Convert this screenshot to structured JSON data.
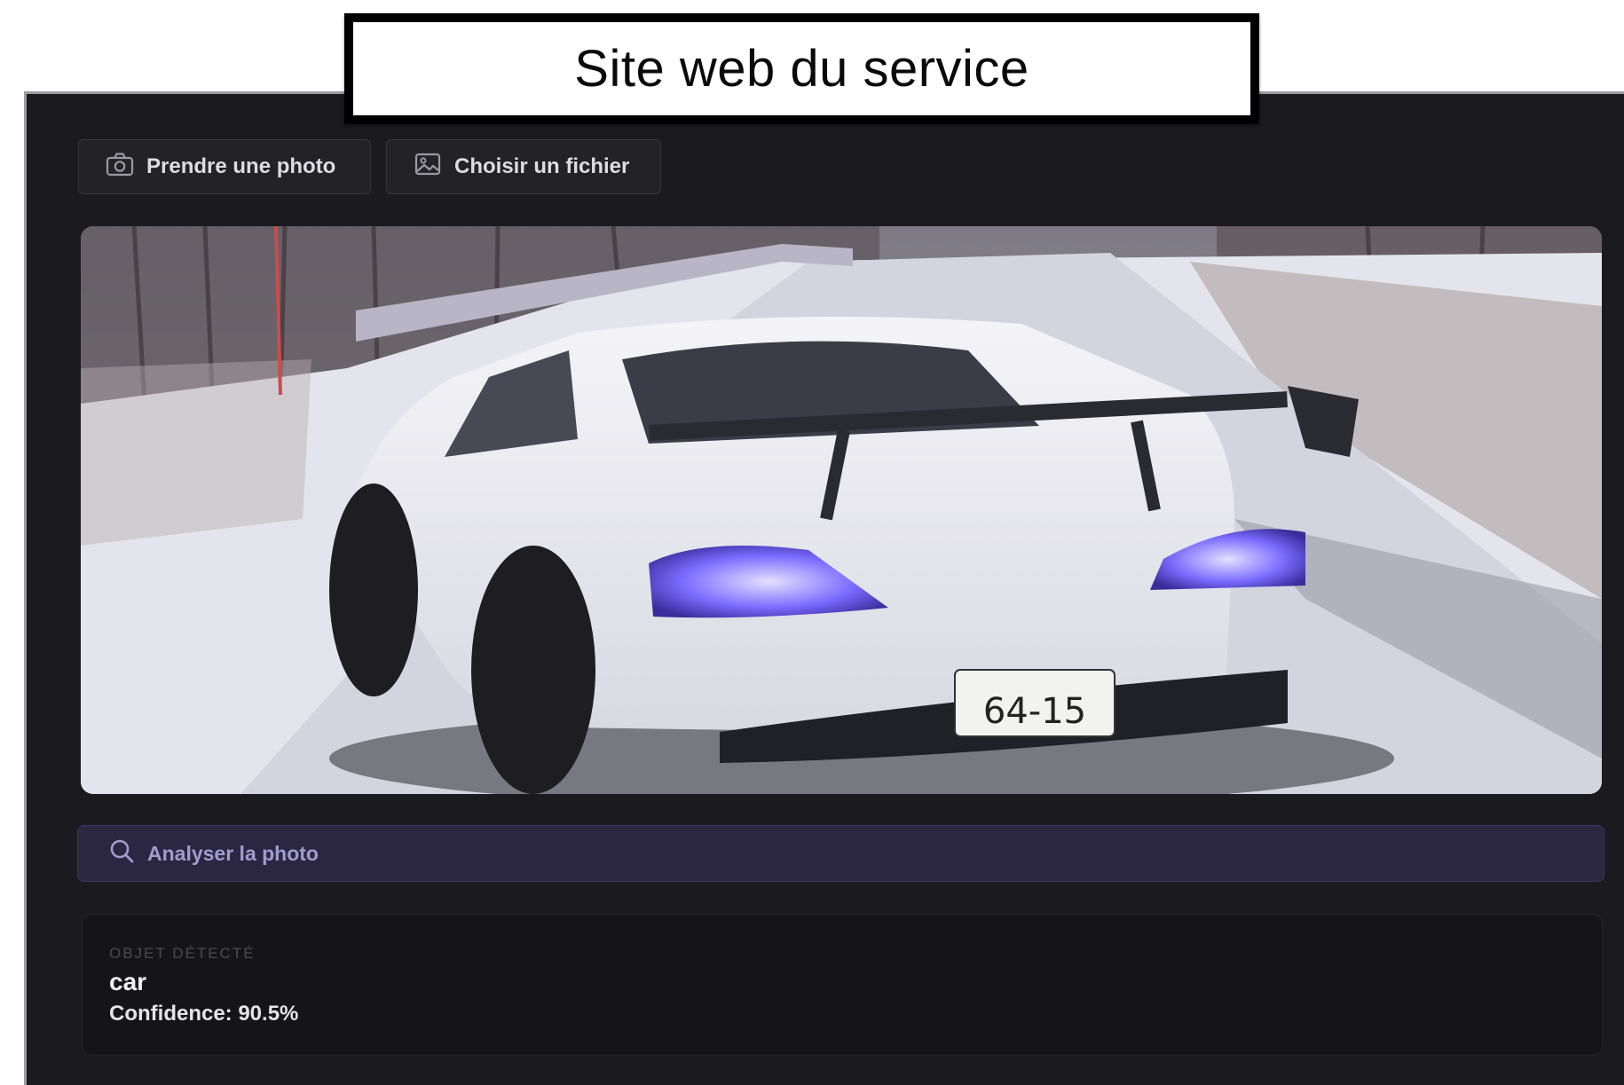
{
  "caption": {
    "text": "Site web du service"
  },
  "toolbar": {
    "take_photo_label": "Prendre une photo",
    "take_photo_icon": "camera-icon",
    "choose_file_label": "Choisir un fichier",
    "choose_file_icon": "image-file-icon"
  },
  "preview": {
    "plate_text": "64-15"
  },
  "analyze": {
    "label": "Analyser la photo",
    "icon": "search-icon"
  },
  "result": {
    "heading": "OBJET DÉTECTÉ",
    "class_label": "car",
    "confidence_text": "Confidence: 90.5%"
  },
  "colors": {
    "window_bg": "#1b1b1f",
    "accent_bar": "#2b2742",
    "accent_text": "#a29ccd"
  }
}
